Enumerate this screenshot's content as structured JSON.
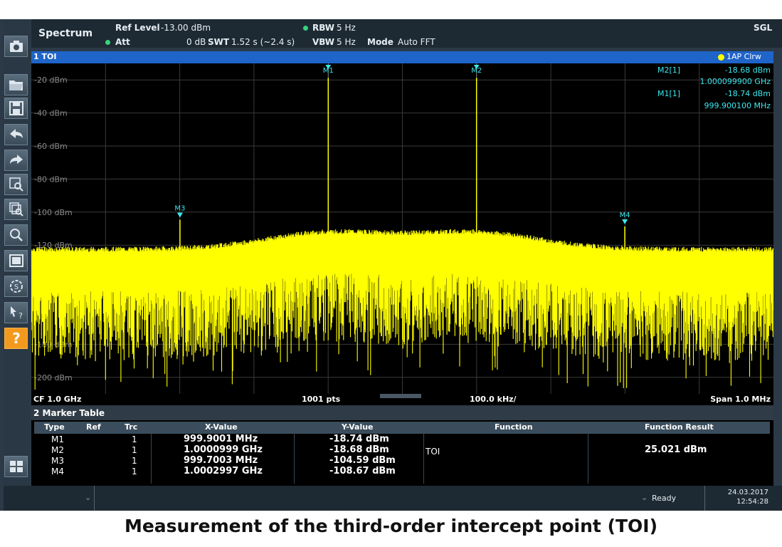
{
  "header": {
    "mode_title": "Spectrum",
    "ref_level_label": "Ref Level",
    "ref_level_value": "-13.00 dBm",
    "att_label": "Att",
    "att_value": "0 dB",
    "swt_label": "SWT",
    "swt_value": "1.52 s (~2.4 s)",
    "rbw_label": "RBW",
    "rbw_value": "5 Hz",
    "vbw_label": "VBW",
    "vbw_value": "5 Hz",
    "mode_label": "Mode",
    "mode_value": "Auto FFT",
    "sweep_mode": "SGL",
    "status_dot_color": "#37d37d"
  },
  "trace_window": {
    "title": "1 TOI",
    "trace_legend": "1AP Clrw",
    "trace_color": "#ffff00",
    "marker_color": "#3ce8ee"
  },
  "marker_readout": [
    {
      "label": "M2[1]",
      "value": "-18.68 dBm",
      "freq": "1.000099900 GHz"
    },
    {
      "label": "M1[1]",
      "value": "-18.74 dBm",
      "freq": "999.900100 MHz"
    }
  ],
  "chart_data": {
    "type": "line",
    "ylim": [
      -210,
      -10
    ],
    "y_ticks": [
      {
        "value": -20,
        "label": "-20 dBm"
      },
      {
        "value": -40,
        "label": "-40 dBm"
      },
      {
        "value": -60,
        "label": "-60 dBm"
      },
      {
        "value": -80,
        "label": "-80 dBm"
      },
      {
        "value": -100,
        "label": "-100 dBm"
      },
      {
        "value": -120,
        "label": "-120 dBm"
      },
      {
        "value": -180,
        "label": "-180 dBm"
      },
      {
        "value": -200,
        "label": "-200 dBm"
      }
    ],
    "x_range_mhz": [
      999.5,
      1000.5
    ],
    "center_freq": "CF 1.0 GHz",
    "points": "1001 pts",
    "div": "100.0 kHz/",
    "span": "Span 1.0 MHz",
    "noise_floor_dbm": -128,
    "series": [
      {
        "peaks_mhz": [
          999.9001,
          1000.0999,
          999.7003,
          1000.2997
        ],
        "peaks_dbm": [
          -18.74,
          -18.68,
          -104.59,
          -108.67
        ]
      }
    ],
    "markers": [
      {
        "label": "M1",
        "x_mhz": 999.9001,
        "y_dbm": -18.74,
        "type": "line"
      },
      {
        "label": "M2",
        "x_mhz": 1000.0999,
        "y_dbm": -18.68,
        "type": "line"
      },
      {
        "label": "M3",
        "x_mhz": 999.7003,
        "y_dbm": -104.59,
        "type": "triangle"
      },
      {
        "label": "M4",
        "x_mhz": 1000.2997,
        "y_dbm": -108.67,
        "type": "triangle"
      }
    ]
  },
  "marker_table": {
    "title": "2 Marker Table",
    "columns": [
      "Type",
      "Ref",
      "Trc",
      "X-Value",
      "Y-Value",
      "Function",
      "Function Result"
    ],
    "rows": [
      {
        "type": "M1",
        "ref": "",
        "trc": "1",
        "x": "999.9001 MHz",
        "y": "-18.74 dBm",
        "func": "",
        "result": ""
      },
      {
        "type": "M2",
        "ref": "",
        "trc": "1",
        "x": "1.0000999 GHz",
        "y": "-18.68 dBm",
        "func": "TOI",
        "result": "25.021 dBm"
      },
      {
        "type": "M3",
        "ref": "",
        "trc": "1",
        "x": "999.7003 MHz",
        "y": "-104.59 dBm",
        "func": "",
        "result": ""
      },
      {
        "type": "M4",
        "ref": "",
        "trc": "1",
        "x": "1.0002997 GHz",
        "y": "-108.67 dBm",
        "func": "",
        "result": ""
      }
    ]
  },
  "status_bar": {
    "ready": "Ready",
    "date": "24.03.2017",
    "time": "12:54:28"
  },
  "toolbar_icons": [
    "camera-icon",
    "open-folder-icon",
    "save-icon",
    "undo-icon",
    "redo-icon",
    "zoom-icon",
    "multi-zoom-icon",
    "zoom-reset-icon",
    "full-screen-icon",
    "sequencer-icon",
    "help-pointer-icon",
    "help-icon"
  ],
  "caption": "Measurement of the third-order intercept point (TOI)"
}
